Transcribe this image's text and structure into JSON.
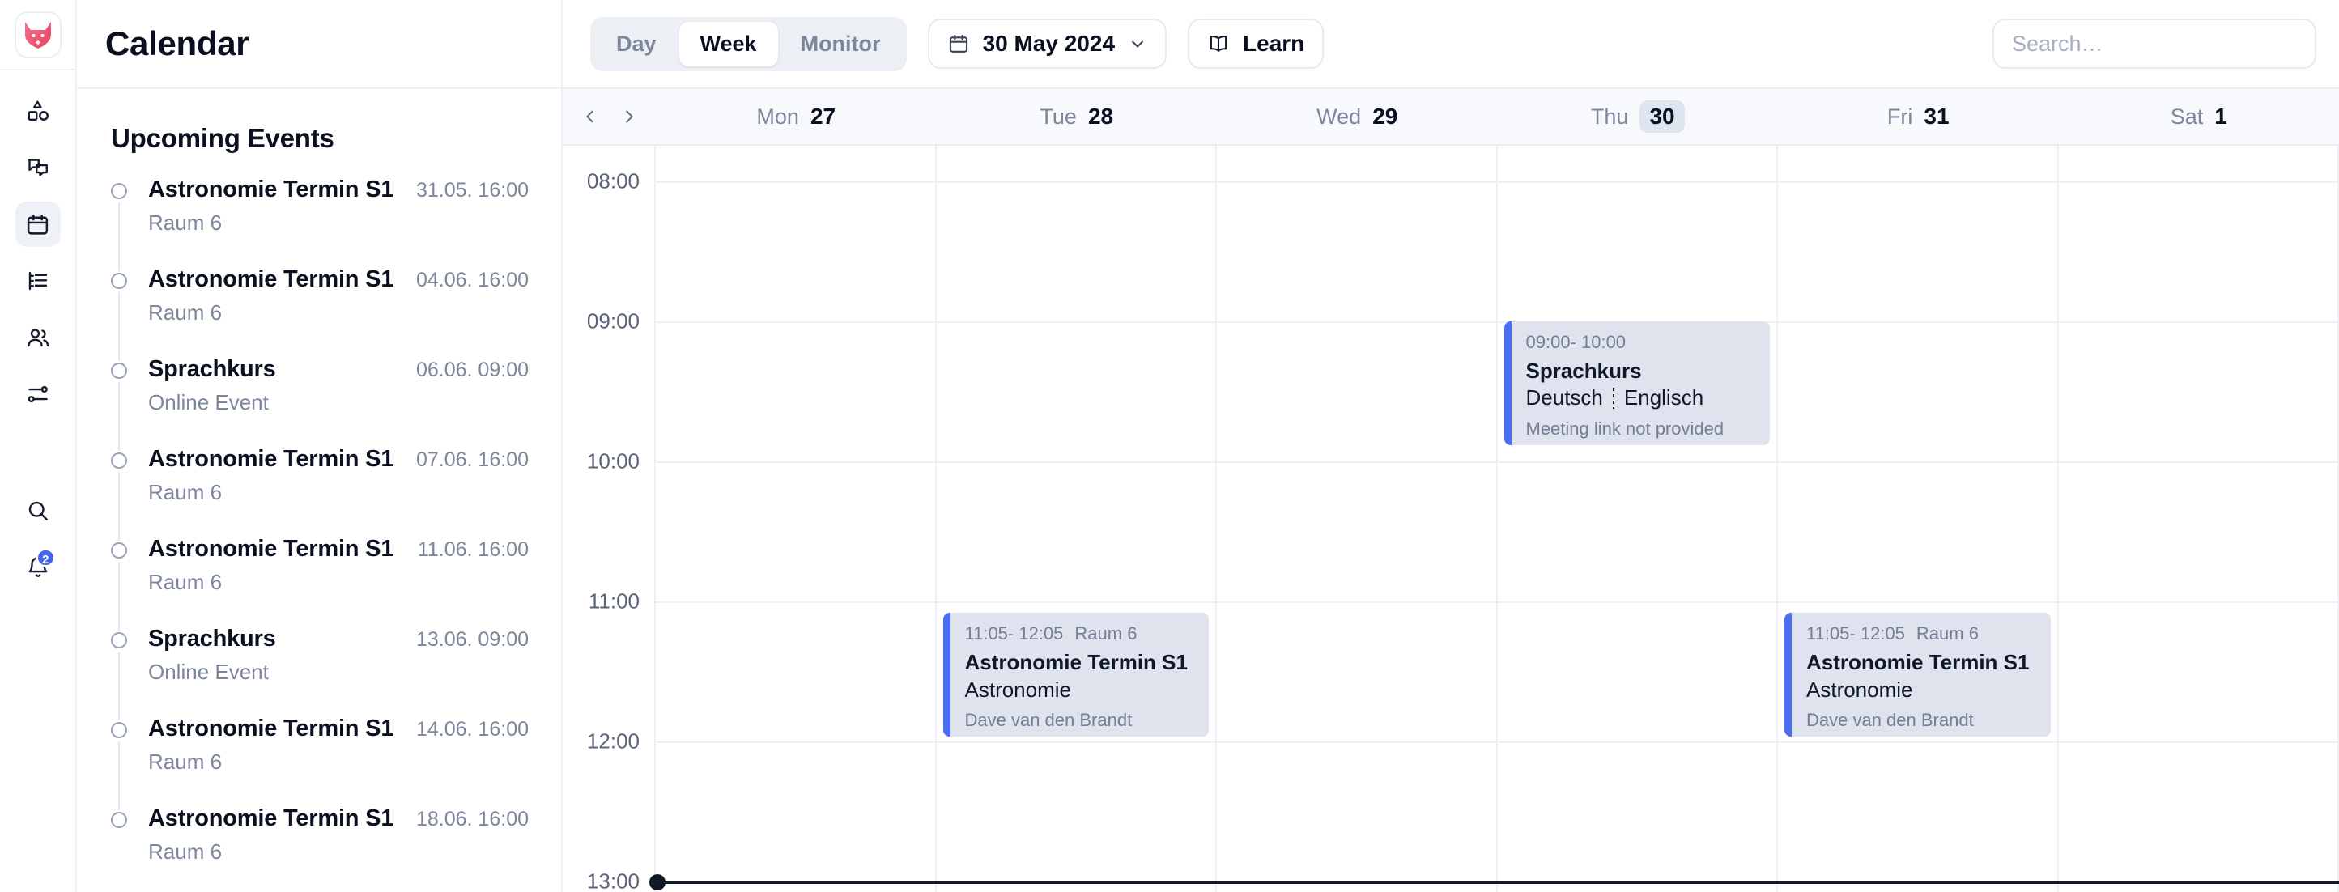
{
  "rail": {
    "logo_icon": "fox-logo",
    "items": [
      {
        "name": "shapes-icon",
        "active": false
      },
      {
        "name": "chat-icon",
        "active": false
      },
      {
        "name": "calendar-icon",
        "active": true
      },
      {
        "name": "list-icon",
        "active": false
      },
      {
        "name": "users-icon",
        "active": false
      },
      {
        "name": "settings-sliders-icon",
        "active": false
      }
    ],
    "bottom": [
      {
        "name": "search-icon",
        "badge": ""
      },
      {
        "name": "bell-icon",
        "badge": "2"
      }
    ],
    "badge_color": "#4263eb"
  },
  "sidebar": {
    "title": "Calendar",
    "section_title": "Upcoming Events",
    "events": [
      {
        "name": "Astronomie Termin S1",
        "when": "31.05. 16:00",
        "location": "Raum 6"
      },
      {
        "name": "Astronomie Termin S1",
        "when": "04.06. 16:00",
        "location": "Raum 6"
      },
      {
        "name": "Sprachkurs",
        "when": "06.06. 09:00",
        "location": "Online Event"
      },
      {
        "name": "Astronomie Termin S1",
        "when": "07.06. 16:00",
        "location": "Raum 6"
      },
      {
        "name": "Astronomie Termin S1",
        "when": "11.06. 16:00",
        "location": "Raum 6"
      },
      {
        "name": "Sprachkurs",
        "when": "13.06. 09:00",
        "location": "Online Event"
      },
      {
        "name": "Astronomie Termin S1",
        "when": "14.06. 16:00",
        "location": "Raum 6"
      },
      {
        "name": "Astronomie Termin S1",
        "when": "18.06. 16:00",
        "location": "Raum 6"
      }
    ]
  },
  "toolbar": {
    "views": [
      {
        "label": "Day",
        "active": false
      },
      {
        "label": "Week",
        "active": true
      },
      {
        "label": "Monitor",
        "active": false
      }
    ],
    "date_label": "30 May 2024",
    "date_icon": "calendar-icon",
    "date_chevron": "chevron-down-icon",
    "learn_label": "Learn",
    "learn_icon": "book-icon",
    "search_placeholder": "Search…",
    "search_value": ""
  },
  "calendar": {
    "prev_icon": "chevron-left-icon",
    "next_icon": "chevron-right-icon",
    "days": [
      {
        "dow": "Mon",
        "num": "27",
        "today": false
      },
      {
        "dow": "Tue",
        "num": "28",
        "today": false
      },
      {
        "dow": "Wed",
        "num": "29",
        "today": false
      },
      {
        "dow": "Thu",
        "num": "30",
        "today": true
      },
      {
        "dow": "Fri",
        "num": "31",
        "today": false
      },
      {
        "dow": "Sat",
        "num": "1",
        "today": false
      }
    ],
    "hours": [
      "08:00",
      "09:00",
      "10:00",
      "11:00",
      "12:00",
      "13:00"
    ],
    "accent_color": "#4c6ef5",
    "event_bg": "#dfe3ee",
    "now_time": "13:00",
    "events": [
      {
        "day_index": 3,
        "time_range": "09:00- 10:00",
        "meta_extra": "",
        "title": "Sprachkurs",
        "subtitle_left": "Deutsch",
        "subtitle_right": "Englisch",
        "footer": "Meeting link not provided",
        "start_hour": 9.0,
        "end_hour": 10.0
      },
      {
        "day_index": 1,
        "time_range": "11:05- 12:05",
        "meta_extra": "Raum 6",
        "title": "Astronomie Termin S1",
        "subtitle_left": "Astronomie",
        "subtitle_right": "",
        "footer": "Dave van den Brandt",
        "start_hour": 11.083,
        "end_hour": 12.083
      },
      {
        "day_index": 4,
        "time_range": "11:05- 12:05",
        "meta_extra": "Raum 6",
        "title": "Astronomie Termin S1",
        "subtitle_left": "Astronomie",
        "subtitle_right": "",
        "footer": "Dave van den Brandt",
        "start_hour": 11.083,
        "end_hour": 12.083
      }
    ]
  }
}
